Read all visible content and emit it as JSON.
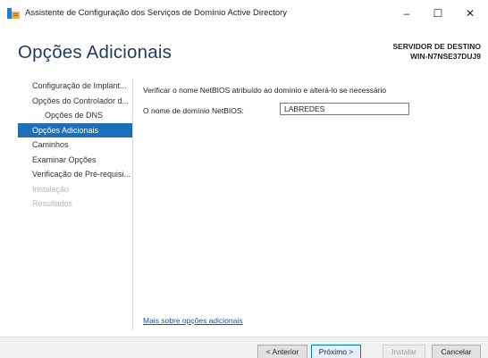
{
  "window": {
    "title": "Assistente de Configuração dos Serviços de Domínio Active Directory",
    "min_glyph": "–",
    "max_glyph": "☐",
    "close_glyph": "✕",
    "icon": "server-manager-icon"
  },
  "header": {
    "page_title": "Opções Adicionais",
    "server_label": "SERVIDOR DE DESTINO",
    "server_name": "WIN-N7NSE37DUJ9"
  },
  "nav": {
    "items": [
      {
        "label": "Configuração de Implant...",
        "state": "normal"
      },
      {
        "label": "Opções do Controlador d...",
        "state": "normal"
      },
      {
        "label": "Opções de DNS",
        "state": "normal"
      },
      {
        "label": "Opções Adicionais",
        "state": "active"
      },
      {
        "label": "Caminhos",
        "state": "normal"
      },
      {
        "label": "Examinar Opções",
        "state": "normal"
      },
      {
        "label": "Verificação de Pré-requisi...",
        "state": "normal"
      },
      {
        "label": "Instalação",
        "state": "disabled"
      },
      {
        "label": "Resultados",
        "state": "disabled"
      }
    ]
  },
  "main": {
    "instruction": "Verificar o nome NetBIOS atribuído ao domínio e alterá-lo se necessário",
    "netbios_label": "O nome de domínio NetBIOS:",
    "netbios_value": "LABREDES",
    "more_link": "Mais sobre opções adicionais"
  },
  "footer": {
    "back": "< Anterior",
    "next": "Próximo >",
    "install": "Instalar",
    "cancel": "Cancelar"
  },
  "colors": {
    "accent": "#1d6fb8",
    "title": "#1f3a5f",
    "link": "#1d4f9e"
  }
}
